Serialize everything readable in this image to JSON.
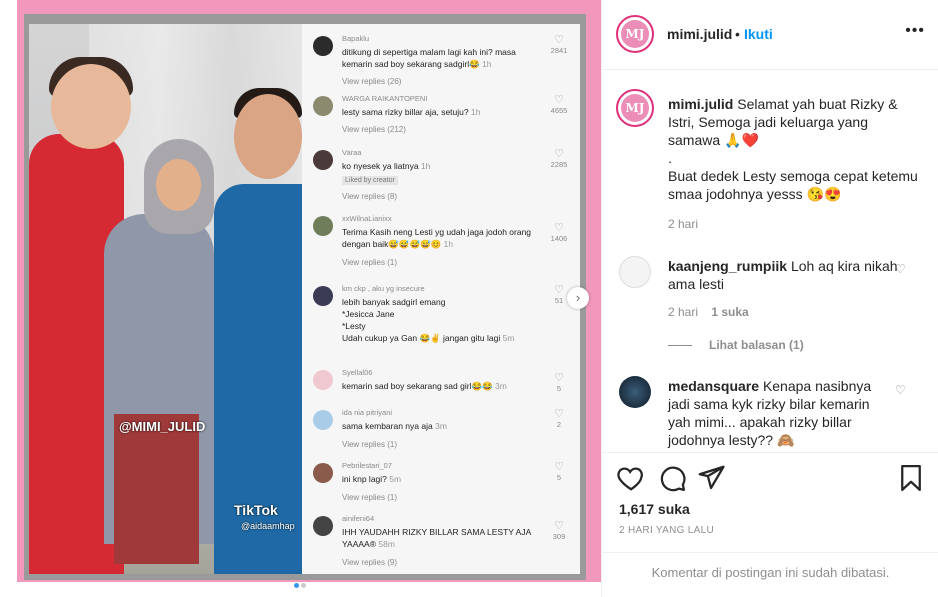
{
  "post_image": {
    "watermark": "@MIMI_JULID",
    "tiktok_logo": "TikTok",
    "tiktok_user": "@aidaamhap",
    "comments": [
      {
        "user": "Bapaklu",
        "text": "ditikung di sepertiga malam lagi kah ini? masa kemarin sad boy sekarang sadgirl😂",
        "time": "1h",
        "replies": "View replies (26)",
        "likes": "2841"
      },
      {
        "user": "WARGA RAIKANTOPENI",
        "text": "lesty sama rizky billar aja, setuju?",
        "time": "1h",
        "replies": "View replies (212)",
        "likes": "4655"
      },
      {
        "user": "Varaa",
        "text": "ko nyesek ya liatnya",
        "time": "1h",
        "badge": "Liked by creator",
        "replies": "View replies (8)",
        "likes": "2285"
      },
      {
        "user": "xxWilnaLianixx",
        "text": "Terima Kasih neng Lesti yg udah jaga jodoh orang dengan baik😅😅😅😅😊",
        "time": "1h",
        "replies": "View replies (1)",
        "likes": "1406"
      },
      {
        "user": "km ckp , aku yg insecure",
        "text": "lebih banyak sadgirl emang\n*Jesicca Jane\n*Lesty\nUdah cukup ya Gan 😂✌ jangan gitu lagi",
        "time": "5m",
        "likes": "51"
      },
      {
        "user": "Syellal06",
        "text": "kemarin sad boy sekarang sad girl😂😂",
        "time": "3m",
        "likes": "5"
      },
      {
        "user": "ida nia pitriyani",
        "text": "sama kembaran nya aja",
        "time": "3m",
        "replies": "View replies (1)",
        "likes": "2"
      },
      {
        "user": "Pebrilestari_07",
        "text": "ini knp lagi?",
        "time": "5m",
        "replies": "View replies (1)",
        "likes": "5"
      },
      {
        "user": "ainifeni64",
        "text": "IHH YAUDAHH RIZKY BILLAR SAMA LESTY AJA YAAAA®",
        "time": "58m",
        "replies": "View replies (9)",
        "likes": "309"
      }
    ],
    "next_icon": "chevron-right-icon"
  },
  "header": {
    "avatar_initials": "MJ",
    "username": "mimi.julid",
    "separator": "•",
    "follow_label": "Ikuti",
    "more_icon": "•••"
  },
  "caption": {
    "username": "mimi.julid",
    "text_1": "Selamat yah buat Rizky & Istri, Semoga jadi keluarga yang samawa 🙏❤️",
    "text_2": ".",
    "text_3": "Buat dedek Lesty semoga cepat ketemu smaa jodohnya yesss 😘😍",
    "time": "2 hari"
  },
  "comments": [
    {
      "username": "kaanjeng_rumpiik",
      "text": "Loh aq kira nikah ama lesti",
      "time": "2 hari",
      "likes": "1 suka",
      "view_replies": "Lihat balasan (1)"
    },
    {
      "username": "medansquare",
      "text": "Kenapa nasibnya jadi sama kyk rizky bilar kemarin yah mimi... apakah rizky billar jodohnya lesty?? 🙈"
    }
  ],
  "actions": {
    "likes": "1,617 suka",
    "date": "2 HARI YANG LALU",
    "comments_limited": "Komentar di postingan ini sudah dibatasi."
  },
  "colors": {
    "frame_pink": "#f198bc",
    "follow_blue": "#0095f6",
    "avatar_ring": "#e0307a"
  }
}
